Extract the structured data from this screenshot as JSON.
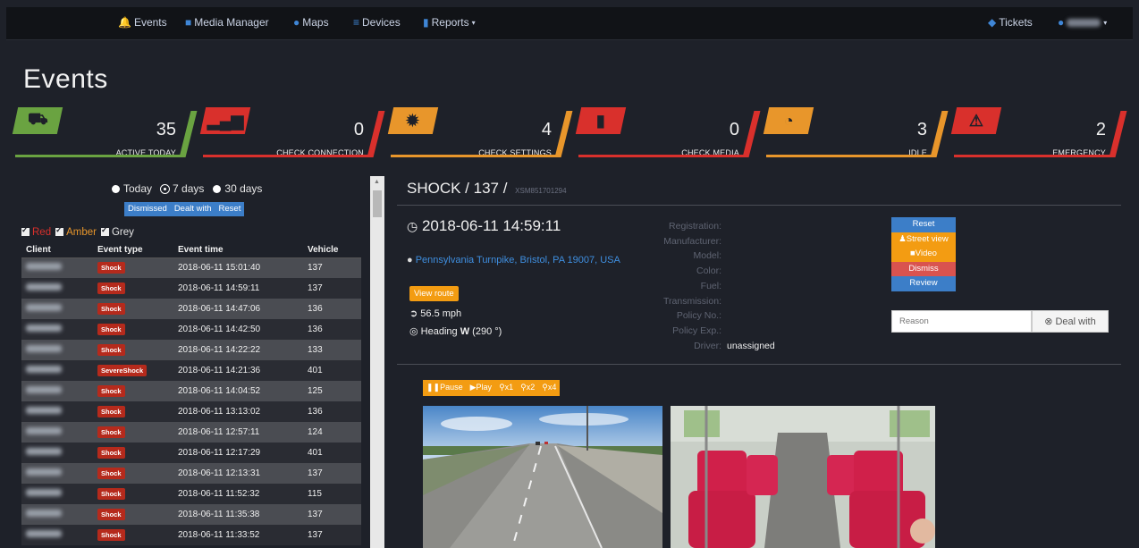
{
  "nav": {
    "events": "Events",
    "media_manager": "Media Manager",
    "maps": "Maps",
    "devices": "Devices",
    "reports": "Reports",
    "tickets": "Tickets"
  },
  "page_title": "Events",
  "cards": [
    {
      "value": "35",
      "label": "ACTIVE TODAY",
      "color": "#6aa341",
      "icon": "car-icon"
    },
    {
      "value": "0",
      "label": "CHECK CONNECTION",
      "color": "#d9302c",
      "icon": "signal-icon"
    },
    {
      "value": "4",
      "label": "CHECK SETTINGS",
      "color": "#e8962b",
      "icon": "gear-icon"
    },
    {
      "value": "0",
      "label": "CHECK MEDIA",
      "color": "#d9302c",
      "icon": "sd-card-icon"
    },
    {
      "value": "3",
      "label": "IDLE",
      "color": "#e8962b",
      "icon": "gauge-icon"
    },
    {
      "value": "2",
      "label": "EMERGENCY",
      "color": "#d9302c",
      "icon": "warning-icon"
    }
  ],
  "range": {
    "today": "Today",
    "seven_days": "7 days",
    "thirty_days": "30 days"
  },
  "buttons": {
    "dismissed": "Dismissed",
    "dealt_with": "Dealt with",
    "reset": "Reset"
  },
  "filters": {
    "red": "Red",
    "amber": "Amber",
    "grey": "Grey"
  },
  "table": {
    "headers": {
      "client": "Client",
      "event_type": "Event type",
      "event_time": "Event time",
      "vehicle": "Vehicle"
    },
    "rows": [
      {
        "type": "Shock",
        "time": "2018-06-11 15:01:40",
        "vehicle": "137"
      },
      {
        "type": "Shock",
        "time": "2018-06-11 14:59:11",
        "vehicle": "137"
      },
      {
        "type": "Shock",
        "time": "2018-06-11 14:47:06",
        "vehicle": "136"
      },
      {
        "type": "Shock",
        "time": "2018-06-11 14:42:50",
        "vehicle": "136"
      },
      {
        "type": "Shock",
        "time": "2018-06-11 14:22:22",
        "vehicle": "133"
      },
      {
        "type": "SevereShock",
        "time": "2018-06-11 14:21:36",
        "vehicle": "401"
      },
      {
        "type": "Shock",
        "time": "2018-06-11 14:04:52",
        "vehicle": "125"
      },
      {
        "type": "Shock",
        "time": "2018-06-11 13:13:02",
        "vehicle": "136"
      },
      {
        "type": "Shock",
        "time": "2018-06-11 12:57:11",
        "vehicle": "124"
      },
      {
        "type": "Shock",
        "time": "2018-06-11 12:17:29",
        "vehicle": "401"
      },
      {
        "type": "Shock",
        "time": "2018-06-11 12:13:31",
        "vehicle": "137"
      },
      {
        "type": "Shock",
        "time": "2018-06-11 11:52:32",
        "vehicle": "115"
      },
      {
        "type": "Shock",
        "time": "2018-06-11 11:35:38",
        "vehicle": "137"
      },
      {
        "type": "Shock",
        "time": "2018-06-11 11:33:52",
        "vehicle": "137"
      }
    ]
  },
  "event": {
    "title": "SHOCK / 137 /",
    "device_id": "XSM851701294",
    "datetime": "2018-06-11 14:59:11",
    "address": "Pennsylvania Turnpike, Bristol, PA 19007, USA",
    "view_route": "View route",
    "speed": "56.5 mph",
    "heading_prefix": "Heading",
    "heading_dir": "W",
    "heading_deg": "(290 °)"
  },
  "details": [
    {
      "key": "Registration:",
      "value": ""
    },
    {
      "key": "Manufacturer:",
      "value": ""
    },
    {
      "key": "Model:",
      "value": ""
    },
    {
      "key": "Color:",
      "value": ""
    },
    {
      "key": "Fuel:",
      "value": ""
    },
    {
      "key": "Transmission:",
      "value": ""
    },
    {
      "key": "Policy No.:",
      "value": ""
    },
    {
      "key": "Policy Exp.:",
      "value": ""
    },
    {
      "key": "Driver:",
      "value": "unassigned"
    }
  ],
  "actions": {
    "reset": "Reset",
    "street_view": "Street view",
    "video": "Video",
    "dismiss": "Dismiss",
    "review": "Review"
  },
  "reason_placeholder": "Reason",
  "deal_with": "Deal with",
  "video_controls": {
    "pause": "Pause",
    "play": "Play",
    "x1": "x1",
    "x2": "x2",
    "x4": "x4"
  },
  "colors": {
    "accent_blue": "#3c7ec8",
    "orange": "#f39c12",
    "red": "#d9302c",
    "green": "#6aa341"
  }
}
